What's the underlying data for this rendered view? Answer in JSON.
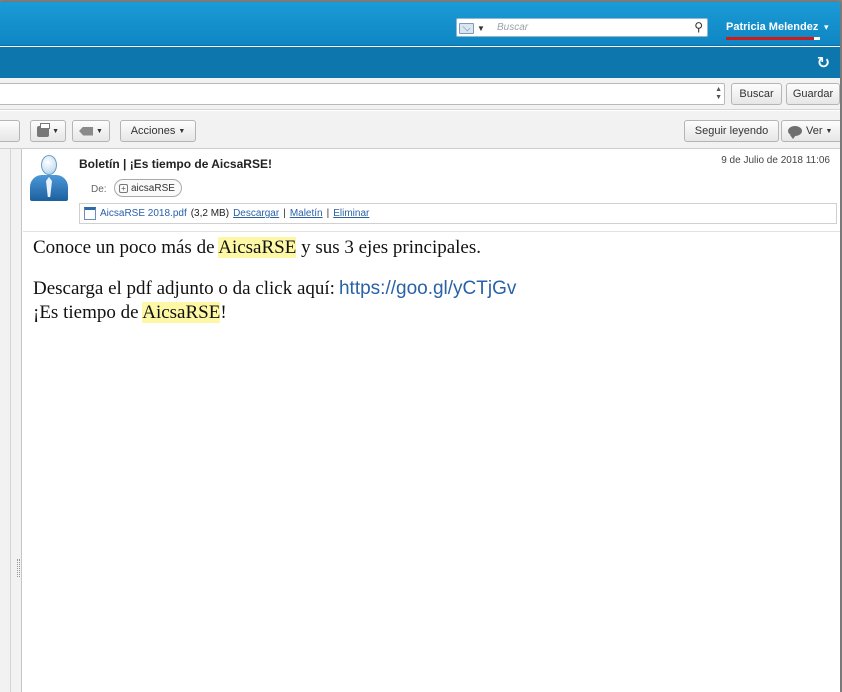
{
  "header": {
    "search_placeholder": "Buscar",
    "user_name": "Patricia Melendez",
    "user_caret": "▾"
  },
  "subbar": {
    "refresh_glyph": "↻"
  },
  "search_row": {
    "search_button": "Buscar",
    "save_button": "Guardar"
  },
  "toolbar": {
    "actions_label": "Acciones",
    "continue_reading_label": "Seguir leyendo",
    "view_label": "Ver",
    "caret": "▼"
  },
  "message": {
    "subject": "Boletín | ¡Es tiempo de AicsaRSE!",
    "date": "9 de Julio de 2018 11:06",
    "from_label": "De:",
    "from_name": "aicsaRSE",
    "attachment": {
      "file_name": "AicsaRSE 2018.pdf",
      "size": "(3,2 MB)",
      "download": "Descargar",
      "briefcase": "Maletín",
      "delete": "Eliminar",
      "separator": "|"
    },
    "body": {
      "line1_pre": "Conoce un poco más de ",
      "line1_hl": "AicsaRSE",
      "line1_post": " y sus 3 ejes principales.",
      "line2_pre": "Descarga el pdf adjunto o da click aquí:",
      "line2_url": "https://goo.gl/yCTjGv",
      "line3_pre": "¡Es tiempo de ",
      "line3_hl": "AicsaRSE",
      "line3_post": "!"
    }
  },
  "colors": {
    "header_blue": "#1a9bd7",
    "subbar_blue": "#0d76ad",
    "user_underline": "#d01919",
    "highlight": "#fdf7a6",
    "link": "#2a62a8"
  },
  "icons": [
    "mail-icon",
    "search-icon",
    "refresh-icon",
    "printer-icon",
    "tag-icon",
    "comment-icon",
    "user-avatar-icon",
    "pdf-file-icon",
    "expand-plus-icon"
  ]
}
